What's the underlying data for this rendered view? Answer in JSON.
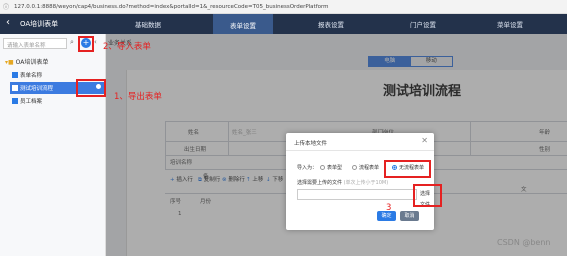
{
  "browser": {
    "url": "127.0.0.1:8888/weyon/cap4/business.do?method=index&portalId=1&_resourceCode=T05_businessOrderPlatform"
  },
  "topnav": {
    "title": "OA培训表单",
    "tabs": [
      "基础数据",
      "表单设置",
      "报表设置",
      "门户设置",
      "菜单设置"
    ],
    "active_tab": "表单设置"
  },
  "sidebar": {
    "search_placeholder": "请输入表单名称",
    "tree_root": "OA培训表单",
    "items": [
      "表单名称",
      "测试培训流程",
      "员工档案"
    ],
    "selected": "测试培训流程"
  },
  "breadcrumb": "业务关系",
  "view_toggle": {
    "pc": "电脑",
    "mobile": "移动"
  },
  "form": {
    "title": "测试培训流程",
    "labels": {
      "name": "姓名",
      "dept": "部门岗位",
      "age": "年龄",
      "birthday": "出生日期",
      "gender": "性别",
      "course": "培训名称",
      "note": "备",
      "no": "序号",
      "month": "月份",
      "one": "1",
      "wen": "文"
    },
    "name_placeholder": "姓名_张三"
  },
  "actions": {
    "insert": "插入行",
    "copy": "复制行",
    "delete": "删除行",
    "up": "上移",
    "down": "下移"
  },
  "modal": {
    "title": "上传本地文件",
    "import_label": "导入为：",
    "radios": [
      "表单型",
      "流程表单",
      "无流程表单"
    ],
    "selected_radio": "无流程表单",
    "choose_label": "选择需要上传的文件",
    "choose_hint": "(单次上传小于10M)",
    "select_btn": "选择文件",
    "ok": "确定",
    "cancel": "取消"
  },
  "annotations": {
    "a1": "1、导出表单",
    "a2": "2、导入表单",
    "a3": "3"
  },
  "watermark": "CSDN @benn",
  "colors": {
    "nav_bg": "#23324b",
    "accent": "#2b7be5",
    "annotation": "#e52121"
  }
}
